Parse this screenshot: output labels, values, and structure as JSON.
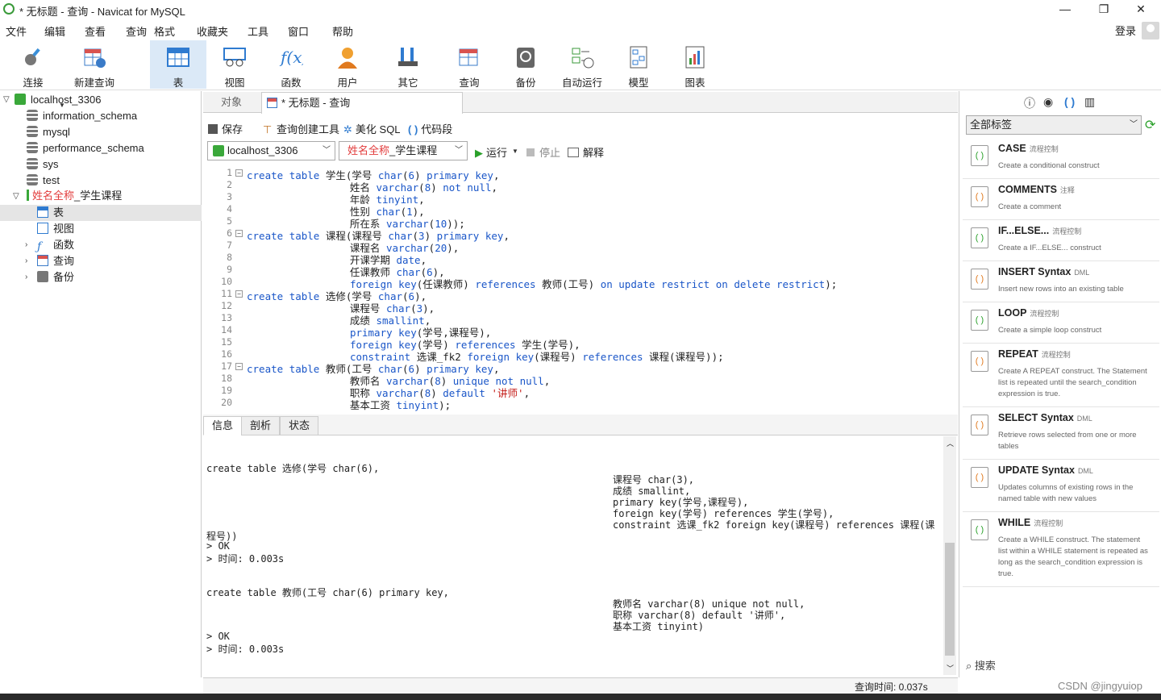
{
  "window": {
    "title": "* 无标题 - 查询 - Navicat for MySQL",
    "min": "—",
    "max": "❐",
    "close": "✕"
  },
  "menu": [
    "文件",
    "编辑",
    "查看",
    "查询",
    "格式",
    "收藏夹",
    "工具",
    "窗口",
    "帮助"
  ],
  "login": "登录",
  "toolbar": [
    "连接",
    "新建查询",
    "表",
    "视图",
    "函数",
    "用户",
    "其它",
    "查询",
    "备份",
    "自动运行",
    "模型",
    "图表"
  ],
  "tree": {
    "connection": "localhost_3306",
    "dbs": [
      "information_schema",
      "mysql",
      "performance_schema",
      "sys",
      "test"
    ],
    "current_db_red": "姓名全称",
    "current_db_rest": "_学生课程",
    "children": [
      "表",
      "视图",
      "函数",
      "查询",
      "备份"
    ]
  },
  "tabs": {
    "objects": "对象",
    "query": "* 无标题 - 查询"
  },
  "qtool": {
    "save": "保存",
    "builder": "查询创建工具",
    "beautify": "美化 SQL",
    "snippet": "代码段"
  },
  "selectors": {
    "conn": "localhost_3306",
    "db_red": "姓名全称",
    "db_rest": "_学生课程",
    "run": "运行",
    "stop": "停止",
    "explain": "解释"
  },
  "code": [
    "create table 学生(学号 char(6) primary key,",
    "                 姓名 varchar(8) not null,",
    "                 年龄 tinyint,",
    "                 性别 char(1),",
    "                 所在系 varchar(10));",
    "create table 课程(课程号 char(3) primary key,",
    "                 课程名 varchar(20),",
    "                 开课学期 date,",
    "                 任课教师 char(6),",
    "                 foreign key(任课教师) references 教师(工号) on update restrict on delete restrict);",
    "create table 选修(学号 char(6),",
    "                 课程号 char(3),",
    "                 成绩 smallint,",
    "                 primary key(学号,课程号),",
    "                 foreign key(学号) references 学生(学号),",
    "                 constraint 选课_fk2 foreign key(课程号) references 课程(课程号));",
    "create table 教师(工号 char(6) primary key,",
    "                 教师名 varchar(8) unique not null,",
    "                 职称 varchar(8) default '讲师',",
    "                 基本工资 tinyint);"
  ],
  "fold_lines": [
    1,
    6,
    11,
    17
  ],
  "restabs": [
    "信息",
    "剖析",
    "状态"
  ],
  "result": [
    {
      "c": 0,
      "t": "create table 选修(学号 char(6),"
    },
    {
      "c": 1,
      "t": "课程号 char(3),"
    },
    {
      "c": 1,
      "t": "成绩 smallint,"
    },
    {
      "c": 1,
      "t": "primary key(学号,课程号),"
    },
    {
      "c": 1,
      "t": "foreign key(学号) references 学生(学号),"
    },
    {
      "c": 1,
      "t": "constraint 选课_fk2 foreign key(课程号) references 课程(课"
    },
    {
      "c": 0,
      "t": "程号))"
    },
    {
      "c": 0,
      "t": "> OK"
    },
    {
      "c": 0,
      "t": "> 时间: 0.003s"
    },
    {
      "c": 0,
      "t": ""
    },
    {
      "c": 0,
      "t": ""
    },
    {
      "c": 0,
      "t": "create table 教师(工号 char(6) primary key,"
    },
    {
      "c": 1,
      "t": "教师名 varchar(8) unique not null,"
    },
    {
      "c": 1,
      "t": "职称 varchar(8) default '讲师',"
    },
    {
      "c": 1,
      "t": "基本工资 tinyint)"
    },
    {
      "c": 0,
      "t": "> OK"
    },
    {
      "c": 0,
      "t": "> 时间: 0.003s"
    }
  ],
  "status": "查询时间: 0.037s",
  "right": {
    "tag": "全部标签",
    "search": "搜索",
    "snippets": [
      {
        "n": "CASE",
        "t": "流程控制",
        "d": "Create a conditional construct"
      },
      {
        "n": "COMMENTS",
        "t": "注释",
        "d": "Create a comment"
      },
      {
        "n": "IF...ELSE...",
        "t": "流程控制",
        "d": "Create a IF...ELSE... construct"
      },
      {
        "n": "INSERT Syntax",
        "t": "DML",
        "d": "Insert new rows into an existing table"
      },
      {
        "n": "LOOP",
        "t": "流程控制",
        "d": "Create a simple loop construct"
      },
      {
        "n": "REPEAT",
        "t": "流程控制",
        "d": "Create A REPEAT construct. The Statement list is repeated until the search_condition expression is true."
      },
      {
        "n": "SELECT Syntax",
        "t": "DML",
        "d": "Retrieve rows selected from one or more tables"
      },
      {
        "n": "UPDATE Syntax",
        "t": "DML",
        "d": "Updates columns of existing rows in the named table with new values"
      },
      {
        "n": "WHILE",
        "t": "流程控制",
        "d": "Create a WHILE construct. The statement list within a WHILE statement is repeated as long as the search_condition expression is true."
      }
    ]
  },
  "watermark": "CSDN @jingyuiop"
}
